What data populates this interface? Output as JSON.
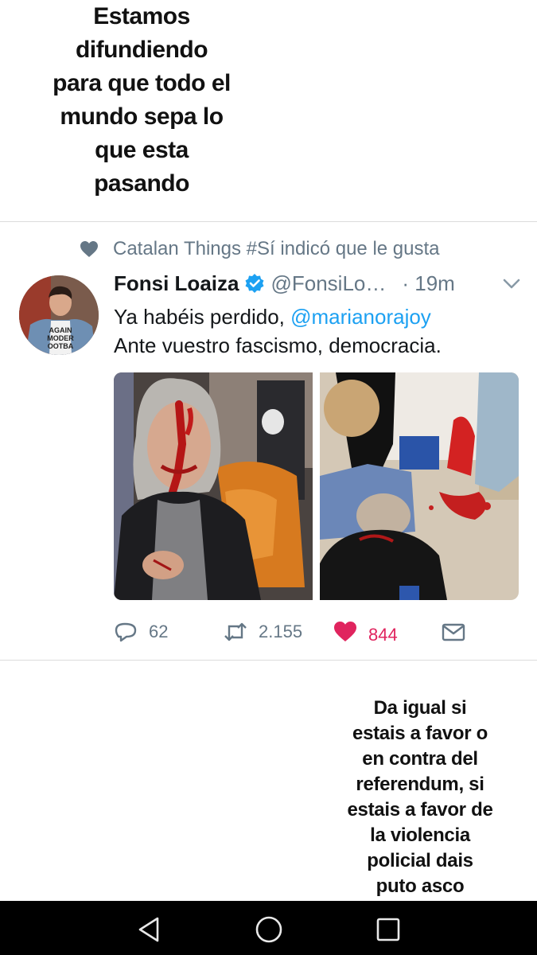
{
  "captions": {
    "top": "Estamos\ndifundiendo\npara que todo el\nmundo sepa lo\nque esta\npasando",
    "bottom": "Da igual si\nestais a favor o\nen contra del\nreferendum, si\nestais a favor de\nla violencia\npolicial dais\nputo asco"
  },
  "social_context": {
    "icon": "heart-icon",
    "text": "Catalan Things #Sí indicó que le gusta"
  },
  "tweet": {
    "name": "Fonsi Loaiza",
    "verified": true,
    "handle": "@FonsiLo…",
    "time": "· 19m",
    "line1_prefix": "Ya habéis perdido, ",
    "mention": "@marianorajoy",
    "line2": "Ante vuestro fascismo, democracia.",
    "avatar_shirt_text": [
      "AGAIN",
      "MODER",
      "OOTBA"
    ]
  },
  "actions": {
    "reply_count": "62",
    "retweet_count": "2.155",
    "like_count": "844",
    "liked": true
  },
  "colors": {
    "accent": "#1da1f2",
    "like": "#e0245e",
    "muted": "#657786",
    "text": "#14171a"
  },
  "navbar": {
    "buttons": [
      "back-icon",
      "home-icon",
      "recents-icon"
    ]
  }
}
